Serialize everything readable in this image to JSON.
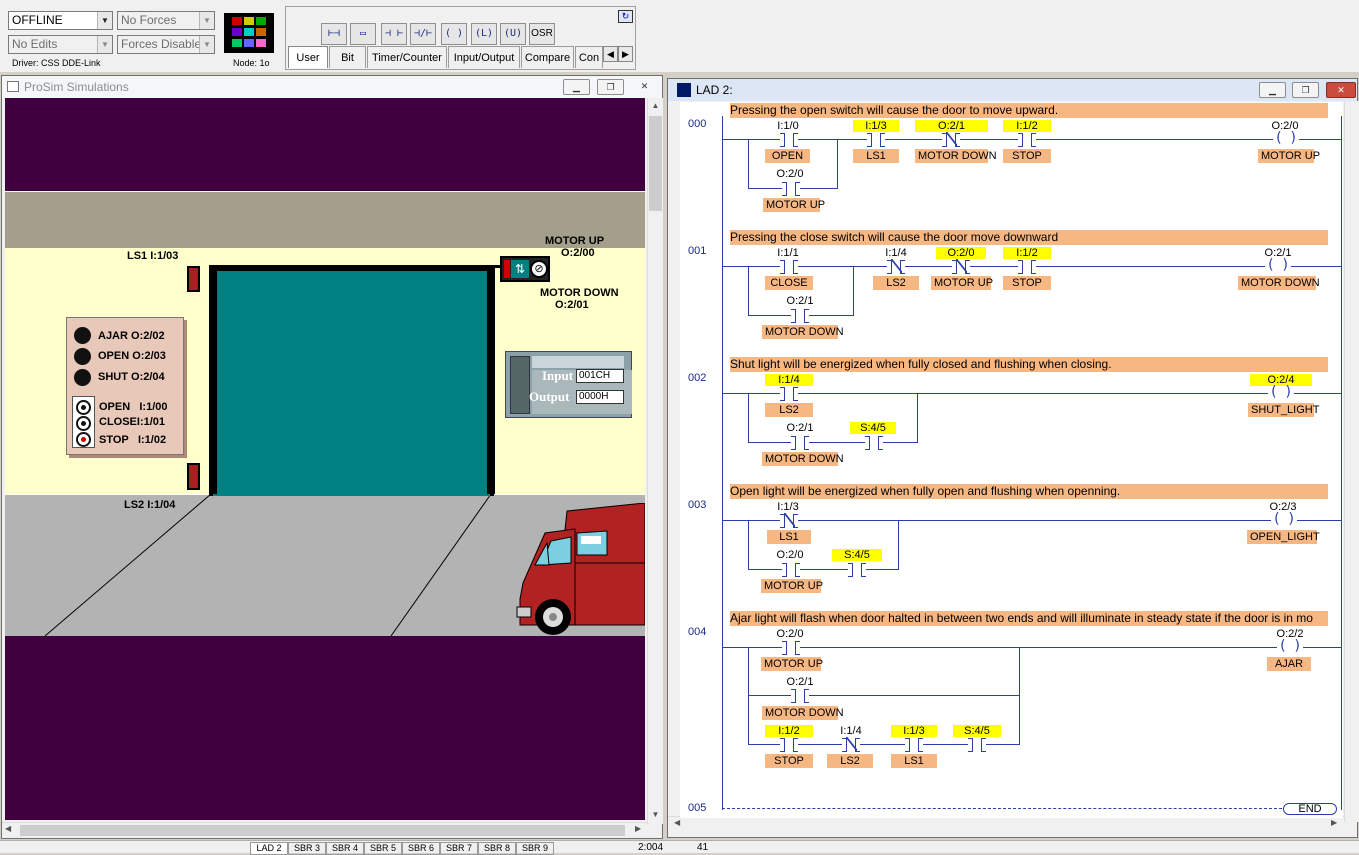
{
  "toolbar": {
    "mode": "OFFLINE",
    "forces": "No Forces",
    "edits": "No Edits",
    "forces_state": "Forces Disabled",
    "driver": "Driver: CSS DDE-Link",
    "node": "Node: 1o",
    "instr_buttons": [
      "⊢⊣",
      "▭",
      "⊣ ⊢",
      "⊣/⊢",
      "(  )",
      "(L)",
      "(U)",
      "OSR"
    ],
    "tabs": [
      "User",
      "Bit",
      "Timer/Counter",
      "Input/Output",
      "Compare",
      "Con"
    ]
  },
  "sim_window": {
    "title": "ProSim Simulations",
    "labels": {
      "ls1": "LS1  I:1/03",
      "ls2": "LS2   I:1/04",
      "motor_up": "MOTOR UP",
      "motor_up_addr": "O:2/00",
      "motor_down": "MOTOR DOWN",
      "motor_down_addr": "O:2/01"
    },
    "panel": {
      "lamps": [
        {
          "label": "AJAR",
          "addr": "O:2/02"
        },
        {
          "label": "OPEN",
          "addr": "O:2/03"
        },
        {
          "label": "SHUT",
          "addr": "O:2/04"
        }
      ],
      "buttons": [
        {
          "label": "OPEN",
          "addr": "I:1/00"
        },
        {
          "label": "CLOSE",
          "addr": "I:1/01"
        },
        {
          "label": "STOP",
          "addr": "I:1/02"
        }
      ]
    },
    "plc": {
      "input_label": "Input",
      "input_value": "001CH",
      "output_label": "Output",
      "output_value": "0000H"
    }
  },
  "lad_window": {
    "title": "LAD 2:",
    "rungs": [
      {
        "num": "000",
        "comment": "Pressing the open switch will cause the door to move upward."
      },
      {
        "num": "001",
        "comment": "Pressing the close switch will cause the door move downward"
      },
      {
        "num": "002",
        "comment": "Shut light will be energized when fully closed and flushing when closing."
      },
      {
        "num": "003",
        "comment": "Open light will be energized when fully open and flushing when openning."
      },
      {
        "num": "004",
        "comment": "Ajar light will flash when door halted in between two ends and will illuminate in steady state if the door is in mo"
      },
      {
        "num": "005",
        "comment": ""
      }
    ],
    "end_label": "END",
    "r0": {
      "a1": "I:1/0",
      "s1": "OPEN",
      "a2": "I:1/3",
      "s2": "LS1",
      "a3": "O:2/1",
      "s3": "MOTOR DOWN",
      "a4": "I:1/2",
      "s4": "STOP",
      "ac": "O:2/0",
      "sc": "MOTOR UP",
      "ab": "O:2/0",
      "sb": "MOTOR UP"
    },
    "r1": {
      "a1": "I:1/1",
      "s1": "CLOSE",
      "a2": "I:1/4",
      "s2": "LS2",
      "a3": "O:2/0",
      "s3": "MOTOR UP",
      "a4": "I:1/2",
      "s4": "STOP",
      "ac": "O:2/1",
      "sc": "MOTOR DOWN",
      "ab": "O:2/1",
      "sb": "MOTOR DOWN"
    },
    "r2": {
      "a1": "I:1/4",
      "s1": "LS2",
      "ac": "O:2/4",
      "sc": "SHUT_LIGHT",
      "ab": "O:2/1",
      "sb": "MOTOR DOWN",
      "ab2": "S:4/5"
    },
    "r3": {
      "a1": "I:1/3",
      "s1": "LS1",
      "ac": "O:2/3",
      "sc": "OPEN_LIGHT",
      "ab": "O:2/0",
      "sb": "MOTOR UP",
      "ab2": "S:4/5"
    },
    "r4": {
      "a1": "O:2/0",
      "s1": "MOTOR UP",
      "ac": "O:2/2",
      "sc": "AJAR",
      "ab": "O:2/1",
      "sb": "MOTOR DOWN",
      "a3": "I:1/2",
      "s3": "STOP",
      "a4": "I:1/4",
      "s4": "LS2",
      "a5": "I:1/3",
      "s5": "LS1",
      "a6": "S:4/5"
    }
  },
  "statusbar": {
    "file_tabs": [
      "LAD 2",
      "SBR 3",
      "SBR 4",
      "SBR 5",
      "SBR 6",
      "SBR 7",
      "SBR 8",
      "SBR 9"
    ],
    "position": "2:004",
    "value": "41"
  }
}
